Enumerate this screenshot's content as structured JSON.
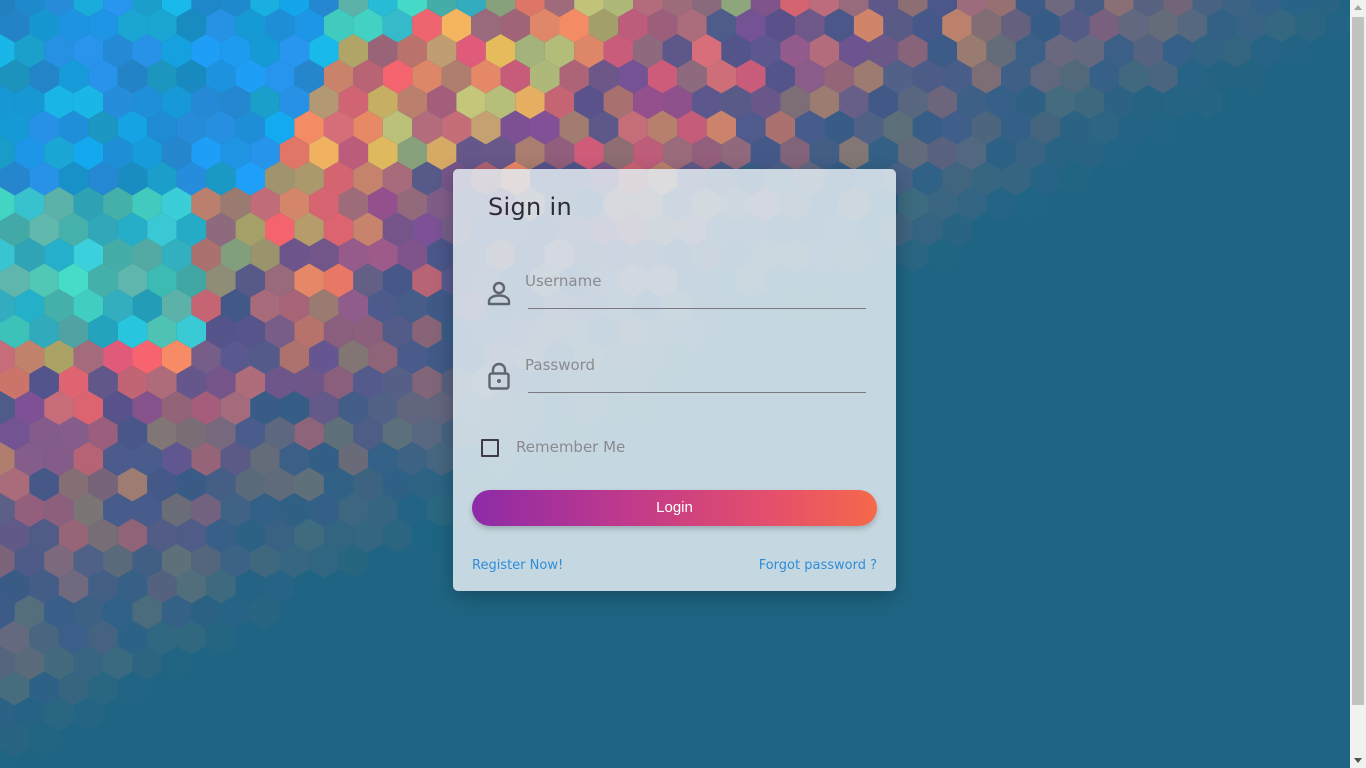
{
  "colors": {
    "background": "#1f6583",
    "card": "#e1eaf0",
    "button_gradient_start": "#8e2aa8",
    "button_gradient_end": "#f5694a",
    "link": "#2f8dd8",
    "title_text": "#2c2c3a",
    "placeholder_text": "#8a8a90"
  },
  "login_form": {
    "title": "Sign in",
    "username": {
      "placeholder": "Username",
      "value": "",
      "icon": "user-icon"
    },
    "password": {
      "placeholder": "Password",
      "value": "",
      "icon": "lock-icon"
    },
    "remember_me": {
      "label": "Remember Me",
      "checked": false
    },
    "login_label": "Login",
    "register_link": "Register Now!",
    "forgot_link": "Forgot password ?"
  }
}
